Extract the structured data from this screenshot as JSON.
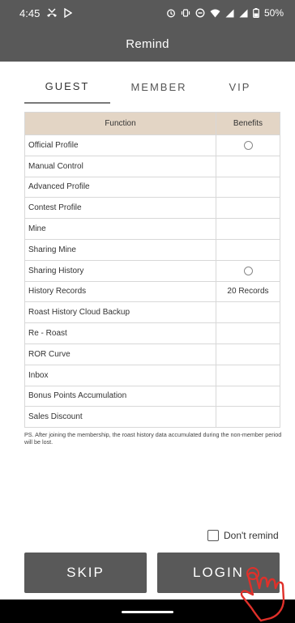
{
  "status": {
    "time": "4:45",
    "battery": "50%",
    "icons": [
      "missed-call-icon",
      "play-store-icon",
      "alarm-icon",
      "vibrate-icon",
      "dnd-icon",
      "wifi-icon",
      "signal-icon",
      "signal-icon",
      "battery-icon"
    ]
  },
  "header": {
    "title": "Remind"
  },
  "tabs": [
    {
      "label": "GUEST",
      "active": true
    },
    {
      "label": "MEMBER",
      "active": false
    },
    {
      "label": "VIP",
      "active": false
    }
  ],
  "table": {
    "headers": [
      "Function",
      "Benefits"
    ],
    "rows": [
      {
        "function": "Official Profile",
        "benefit": "",
        "icon": "circle"
      },
      {
        "function": "Manual Control",
        "benefit": ""
      },
      {
        "function": "Advanced Profile",
        "benefit": ""
      },
      {
        "function": "Contest Profile",
        "benefit": ""
      },
      {
        "function": "Mine",
        "benefit": ""
      },
      {
        "function": "Sharing Mine",
        "benefit": ""
      },
      {
        "function": "Sharing History",
        "benefit": "",
        "icon": "circle"
      },
      {
        "function": "History Records",
        "benefit": "20 Records"
      },
      {
        "function": "Roast History Cloud Backup",
        "benefit": ""
      },
      {
        "function": "Re - Roast",
        "benefit": ""
      },
      {
        "function": "ROR Curve",
        "benefit": ""
      },
      {
        "function": "Inbox",
        "benefit": ""
      },
      {
        "function": "Bonus Points Accumulation",
        "benefit": ""
      },
      {
        "function": "Sales Discount",
        "benefit": ""
      }
    ]
  },
  "note": "PS. After joining the membership, the roast history data accumulated during the non-member period will be lost.",
  "remind": {
    "label": "Don't remind",
    "checked": false
  },
  "buttons": {
    "skip": "SKIP",
    "login": "LOGIN"
  },
  "colors": {
    "bar": "#595959",
    "header_cell": "#e3d5c5",
    "button": "#595959",
    "hand": "#e0302a"
  }
}
